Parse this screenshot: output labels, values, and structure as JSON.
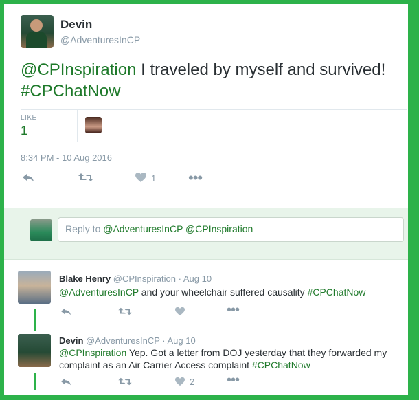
{
  "tweet": {
    "author_name": "Devin",
    "author_handle": "@AdventuresInCP",
    "mention": "@CPInspiration",
    "text_main": " I traveled by myself and survived! ",
    "hashtag": "#CPChatNow",
    "likes_label": "LIKE",
    "likes_count": "1",
    "timestamp": "8:34 PM - 10 Aug 2016",
    "actions": {
      "like_count": "1"
    }
  },
  "reply_composer": {
    "prefix": "Reply to ",
    "mentions": "@AdventuresInCP @CPInspiration"
  },
  "conversation": [
    {
      "name": "Blake Henry",
      "handle": "@CPInspiration",
      "date": "Aug 10",
      "mention": "@AdventuresInCP",
      "text": " and your wheelchair suffered causality ",
      "hashtag": "#CPChatNow",
      "like_count": ""
    },
    {
      "name": "Devin",
      "handle": "@AdventuresInCP",
      "date": "Aug 10",
      "mention": "@CPInspiration",
      "text": " Yep. Got a letter from DOJ yesterday that they forwarded my complaint as an Air Carrier Access complaint ",
      "hashtag": "#CPChatNow",
      "like_count": "2"
    }
  ],
  "colors": {
    "accent": "#1f7a2b",
    "border": "#2db24a",
    "muted": "#8899a6"
  }
}
